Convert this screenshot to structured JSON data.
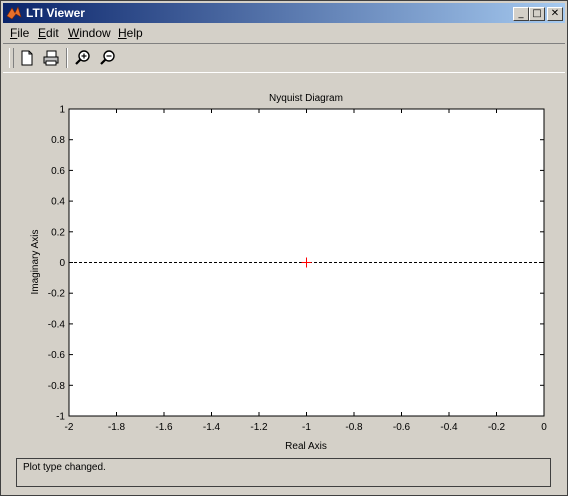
{
  "window": {
    "title": "LTI Viewer"
  },
  "menu": [
    {
      "label": "File",
      "key": "F",
      "rest": "ile"
    },
    {
      "label": "Edit",
      "key": "E",
      "rest": "dit"
    },
    {
      "label": "Window",
      "key": "W",
      "rest": "indow"
    },
    {
      "label": "Help",
      "key": "H",
      "rest": "elp"
    }
  ],
  "toolbar": {
    "icons": [
      "new-file-icon",
      "print-icon",
      "zoom-in-icon",
      "zoom-out-icon"
    ]
  },
  "status": {
    "text": "Plot type changed."
  },
  "colors": {
    "titlebar_start": "#0a246a",
    "titlebar_end": "#a6caf0",
    "marker": "#ff0000",
    "background": "#d4d0c8"
  },
  "chart_data": {
    "type": "scatter",
    "title": "Nyquist Diagram",
    "xlabel": "Real Axis",
    "ylabel": "Imaginary Axis",
    "xlim": [
      -2,
      0
    ],
    "ylim": [
      -1,
      1
    ],
    "xticks": [
      -2,
      -1.8,
      -1.6,
      -1.4,
      -1.2,
      -1,
      -0.8,
      -0.6,
      -0.4,
      -0.2,
      0
    ],
    "yticks": [
      -1,
      -0.8,
      -0.6,
      -0.4,
      -0.2,
      0,
      0.2,
      0.4,
      0.6,
      0.8,
      1
    ],
    "reference_line": {
      "y": 0,
      "style": "dashed"
    },
    "points": [
      {
        "x": -1,
        "y": 0,
        "marker": "+",
        "color": "#ff0000"
      }
    ],
    "grid": false
  }
}
